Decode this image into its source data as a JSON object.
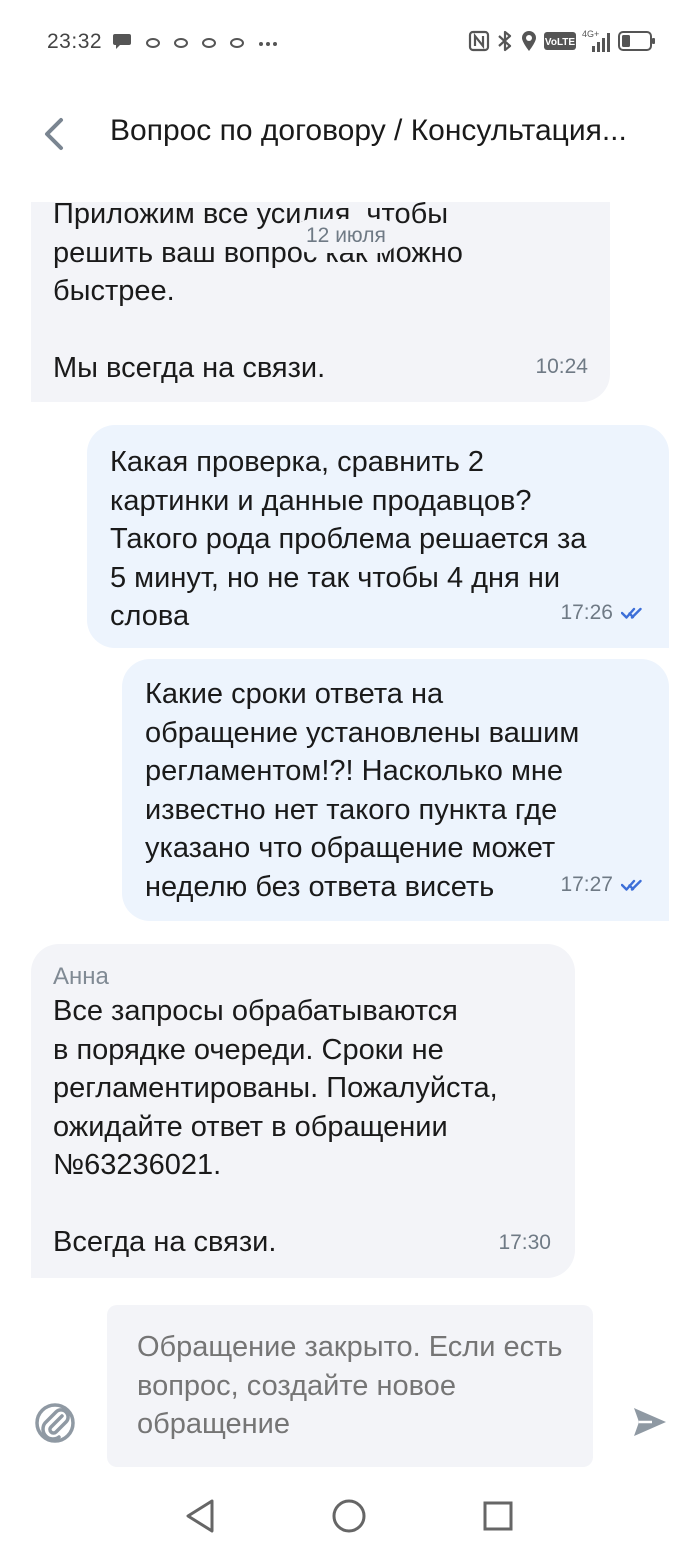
{
  "status_bar": {
    "time": "23:32",
    "volte_label": "VoLTE",
    "network_label": "4G+",
    "icons_left": [
      "chat-bubble-icon",
      "ring-icon",
      "ring-icon",
      "ring-icon",
      "ring-icon",
      "more-dots-icon"
    ],
    "icons_right": [
      "nfc-icon",
      "bluetooth-icon",
      "location-icon",
      "volte-icon",
      "signal-icon",
      "battery-icon"
    ]
  },
  "header": {
    "title": "Вопрос по договору / Консультация..."
  },
  "chat": {
    "date_chip": "12 июля",
    "messages": [
      {
        "direction": "incoming",
        "sender": "",
        "text": "Приложим все усилия, чтобы\nрешить ваш вопрос как можно\nбыстрее.\n\nМы всегда на связи.",
        "time": "10:24",
        "read": false
      },
      {
        "direction": "outgoing",
        "sender": "",
        "text": "Какая проверка, сравнить 2\nкартинки и данные продавцов?\nТакого рода проблема решается за\n5 минут, но не так чтобы 4 дня ни\nслова",
        "time": "17:26",
        "read": true
      },
      {
        "direction": "outgoing",
        "sender": "",
        "text": "Какие сроки ответа на\nобращение установлены   вашим\nрегламентом!?! Насколько мне\nизвестно нет такого пункта где\nуказано что обращение может\nнеделю без ответа висеть",
        "time": "17:27",
        "read": true
      },
      {
        "direction": "incoming",
        "sender": "Анна",
        "text": "Все запросы обрабатываются\nв порядке очереди. Сроки не\nрегламентированы. Пожалуйста,\nожидайте ответ в обращении\n№63236021.\n\nВсегда на связи.",
        "time": "17:30",
        "read": false
      }
    ]
  },
  "composer": {
    "placeholder": "Обращение закрыто. Если есть вопрос, создайте новое обращение",
    "attach_icon": "paperclip-icon",
    "send_icon": "send-icon"
  },
  "nav_bar": {
    "icons": [
      "back-triangle-icon",
      "home-circle-icon",
      "recents-square-icon"
    ]
  },
  "colors": {
    "incoming_bubble": "#f3f4f8",
    "outgoing_bubble": "#edf4fd",
    "read_check": "#3d6fd8",
    "meta_text": "#6f7a85"
  }
}
